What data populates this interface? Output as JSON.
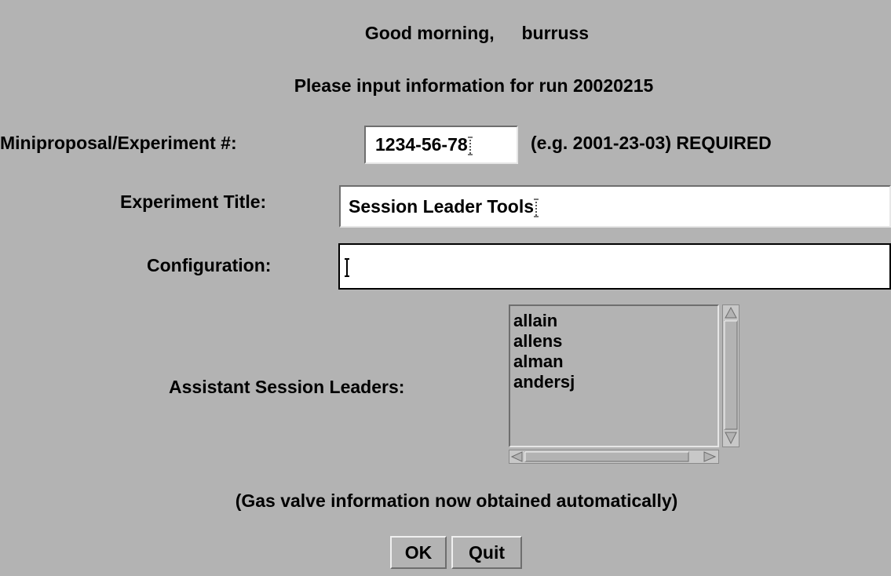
{
  "greeting": {
    "prefix": "Good morning,",
    "username": "burruss"
  },
  "run_prompt": "Please input information for run 20020215",
  "miniproposal": {
    "label": "Miniproposal/Experiment #:",
    "value": "1234-56-78",
    "hint": "(e.g. 2001-23-03)  REQUIRED"
  },
  "experiment_title": {
    "label": "Experiment Title:",
    "value": "Session Leader Tools"
  },
  "configuration": {
    "label": "Configuration:",
    "value": ""
  },
  "assistants": {
    "label": "Assistant Session Leaders:",
    "options": [
      "allain",
      "allens",
      "alman",
      "andersj"
    ]
  },
  "gas_note": "(Gas valve information now obtained automatically)",
  "buttons": {
    "ok": "OK",
    "quit": "Quit"
  },
  "colors": {
    "background": "#b3b3b3",
    "field": "#ffffff",
    "text": "#000000"
  }
}
